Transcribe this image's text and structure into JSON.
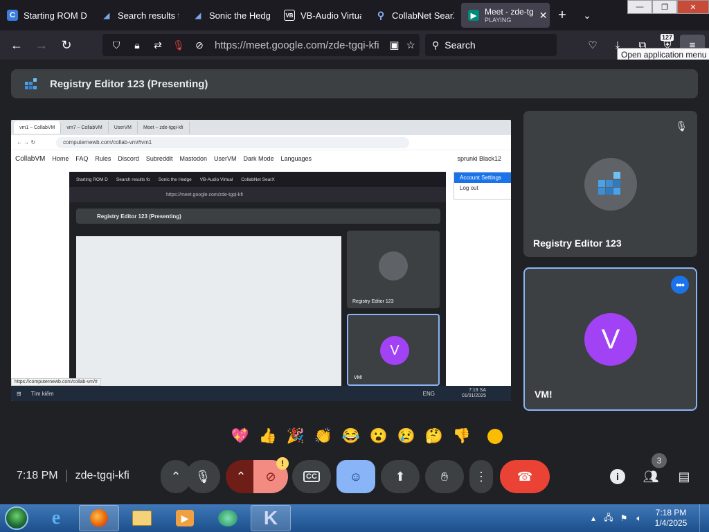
{
  "browser": {
    "tabs": [
      {
        "title": "Starting ROM D",
        "icon": "collabvm-icon",
        "sub": ""
      },
      {
        "title": "Search results fo",
        "icon": "sonic-icon",
        "sub": ""
      },
      {
        "title": "Sonic the Hedge",
        "icon": "sonic-icon",
        "sub": ""
      },
      {
        "title": "VB-Audio Virtual",
        "icon": "vb-audio-icon",
        "sub": ""
      },
      {
        "title": "CollabNet SearX",
        "icon": "search-icon",
        "sub": ""
      },
      {
        "title": "Meet - zde-tg",
        "icon": "meet-icon",
        "sub": "PLAYING"
      }
    ],
    "url": "https://meet.google.com/zde-tgqi-kfi",
    "search_placeholder": "Search",
    "downloads_badge": "127",
    "tooltip": "Open application menu"
  },
  "meet": {
    "presenting_title": "Registry Editor 123 (Presenting)",
    "participants": [
      {
        "name": "Registry Editor 123",
        "muted": true
      },
      {
        "name": "VM!",
        "initial": "V"
      }
    ],
    "reactions": [
      "💖",
      "👍",
      "🎉",
      "👏",
      "😂",
      "😮",
      "😢",
      "🤔",
      "👎"
    ],
    "time": "7:18 PM",
    "meeting_code": "zde-tgqi-kfi",
    "people_count": "3",
    "warning": "!"
  },
  "shared_screen": {
    "tabs": [
      "vm1 – CollabVM",
      "vm7 – CollabVM",
      "UserVM",
      "Meet – zde-tgqi-kfi"
    ],
    "url": "computernewb.com/collab-vm/#vm1",
    "menu": [
      "CollabVM",
      "Home",
      "FAQ",
      "Rules",
      "Discord",
      "Subreddit",
      "Mastodon",
      "UserVM",
      "Dark Mode",
      "Languages"
    ],
    "user": "sprunki Black12",
    "context_menu": [
      "Account Settings",
      "Log out"
    ],
    "inner_presenting": "Registry Editor 123 (Presenting)",
    "inner_tiles": [
      "Registry Editor 123",
      "VM!"
    ],
    "inner_initial": "V",
    "status_url": "https://computernewb.com/collab-vm/#",
    "taskbar_search": "Tìm kiếm",
    "taskbar_lang": "ENG",
    "taskbar_time": "7:19 SA",
    "taskbar_date": "01/01/2025"
  },
  "taskbar": {
    "time": "7:18 PM",
    "date": "1/4/2025"
  }
}
